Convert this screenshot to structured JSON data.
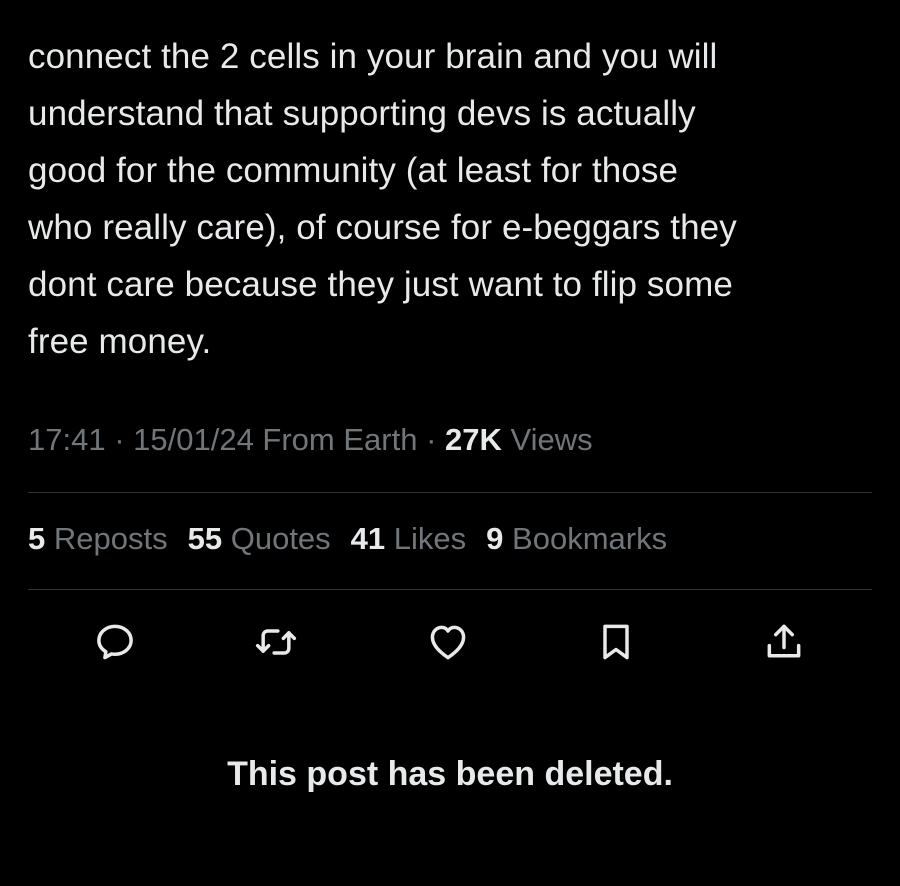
{
  "post": {
    "text": "connect the 2 cells in your brain and you will\nunderstand that supporting devs is actually\ngood for the community (at least for those\nwho really care), of course for e-beggars they\ndont care because they just want to flip some\nfree money.",
    "time": "17:41",
    "sep1": " · ",
    "date": "15/01/24",
    "source": " From Earth",
    "sep2": " · ",
    "views_count": "27K",
    "views_label": " Views"
  },
  "stats": [
    {
      "count": "5",
      "label": "Reposts"
    },
    {
      "count": "55",
      "label": "Quotes"
    },
    {
      "count": "41",
      "label": "Likes"
    },
    {
      "count": "9",
      "label": "Bookmarks"
    }
  ],
  "actions": {
    "reply_icon": "reply-icon",
    "repost_icon": "repost-icon",
    "like_icon": "heart-icon",
    "bookmark_icon": "bookmark-icon",
    "share_icon": "share-icon"
  },
  "notice": {
    "deleted": "This post has been deleted."
  },
  "colors": {
    "background": "#000000",
    "text_primary": "#e7e9ea",
    "text_secondary": "#71767b",
    "divider": "#2f3336"
  }
}
